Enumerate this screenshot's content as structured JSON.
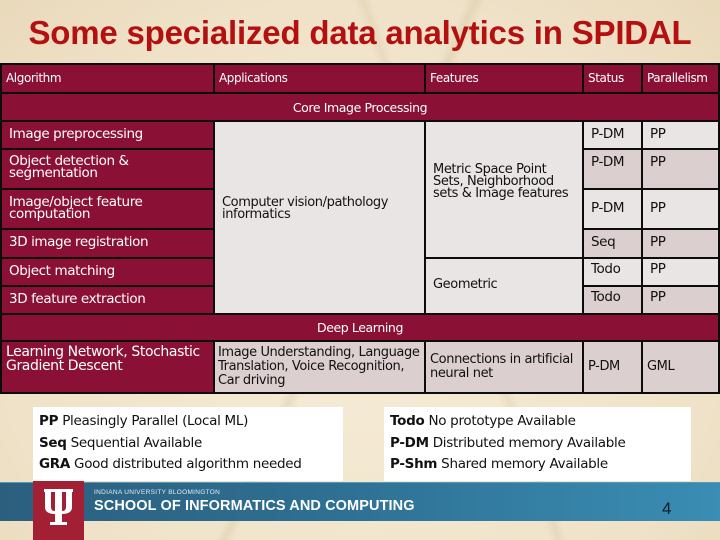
{
  "title": "Some specialized data analytics in SPIDAL",
  "table": {
    "headers": [
      "Algorithm",
      "Applications",
      "Features",
      "Status",
      "Parallelism"
    ],
    "sections": [
      {
        "label": "Core Image Processing",
        "application": "Computer vision/pathology informatics",
        "feature_groups": [
          "Metric Space Point Sets, Neighborhood sets & Image features",
          "Geometric"
        ],
        "rows": [
          {
            "algorithm": "Image preprocessing",
            "status": "P-DM",
            "parallelism": "PP"
          },
          {
            "algorithm": "Object detection & segmentation",
            "status": "P-DM",
            "parallelism": "PP"
          },
          {
            "algorithm": "Image/object feature computation",
            "status": "P-DM",
            "parallelism": "PP"
          },
          {
            "algorithm": "3D image registration",
            "status": "Seq",
            "parallelism": "PP"
          },
          {
            "algorithm": "Object matching",
            "status": "Todo",
            "parallelism": "PP"
          },
          {
            "algorithm": "3D feature extraction",
            "status": "Todo",
            "parallelism": "PP"
          }
        ]
      },
      {
        "label": "Deep Learning",
        "rows": [
          {
            "algorithm": "Learning Network, Stochastic Gradient Descent",
            "application": "Image Understanding, Language Translation, Voice Recognition, Car driving",
            "feature": "Connections in artificial neural net",
            "status": "P-DM",
            "parallelism": "GML"
          }
        ]
      }
    ]
  },
  "legend_left": [
    {
      "abbr": "PP",
      "text": "Pleasingly Parallel (Local ML)"
    },
    {
      "abbr": "Seq",
      "text": "Sequential Available"
    },
    {
      "abbr": "GRA",
      "text": "Good distributed algorithm needed"
    }
  ],
  "legend_right": [
    {
      "abbr": "Todo",
      "text": "No prototype Available"
    },
    {
      "abbr": "P-DM",
      "text": "Distributed memory Available"
    },
    {
      "abbr": "P-Shm",
      "text": "Shared memory Available"
    }
  ],
  "footer": {
    "university": "INDIANA UNIVERSITY BLOOMINGTON",
    "school": "SCHOOL OF INFORMATICS AND COMPUTING",
    "page_number": "4"
  },
  "colors": {
    "title": "#b3100f",
    "header_bg": "#8b1036",
    "row_light": "#eae5e5",
    "row_dark": "#dccfd0",
    "footer_bar": "#2e6f92",
    "logo_red": "#a31f34"
  }
}
